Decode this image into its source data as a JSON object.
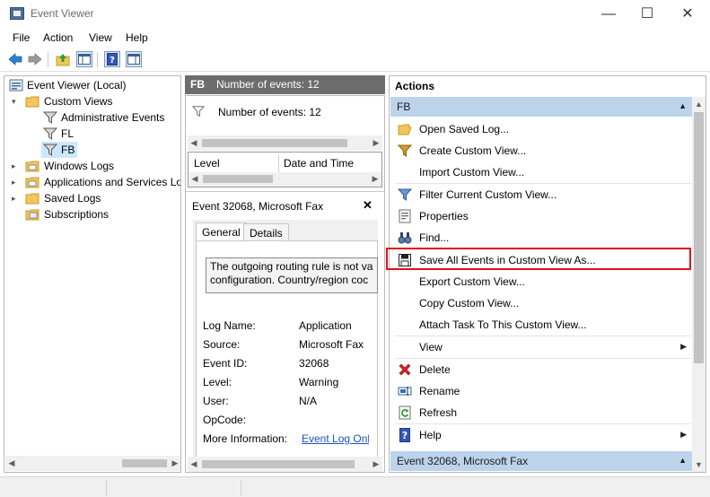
{
  "window": {
    "title": "Event Viewer",
    "min_glyph": "—",
    "max_glyph": "☐",
    "close_glyph": "✕"
  },
  "menu": [
    "File",
    "Action",
    "View",
    "Help"
  ],
  "tree": {
    "items": [
      {
        "label": "Event Viewer (Local)",
        "icon": "event-viewer-icon"
      },
      {
        "label": "Custom Views",
        "icon": "folder-icon"
      },
      {
        "label": "Administrative Events",
        "icon": "filter-icon"
      },
      {
        "label": "FL",
        "icon": "filter-icon"
      },
      {
        "label": "FB",
        "icon": "filter-icon"
      },
      {
        "label": "Windows Logs",
        "icon": "folder-icon"
      },
      {
        "label": "Applications and Services Lo",
        "icon": "folder-icon"
      },
      {
        "label": "Saved Logs",
        "icon": "folder-icon"
      },
      {
        "label": "Subscriptions",
        "icon": "subscriptions-icon"
      }
    ]
  },
  "middle": {
    "header_name": "FB",
    "header_count": "Number of events: 12",
    "filter_text": "Number of events: 12",
    "columns": [
      "Level",
      "Date and Time"
    ],
    "event_title": "Event 32068, Microsoft Fax",
    "close_glyph": "✕",
    "tabs": [
      "General",
      "Details"
    ],
    "message_line1": "The outgoing routing rule is not va",
    "message_line2": "configuration. Country/region coc",
    "props": [
      {
        "label": "Log Name:",
        "value": "Application"
      },
      {
        "label": "Source:",
        "value": "Microsoft Fax"
      },
      {
        "label": "Event ID:",
        "value": "32068"
      },
      {
        "label": "Level:",
        "value": "Warning"
      },
      {
        "label": "User:",
        "value": "N/A"
      },
      {
        "label": "OpCode:",
        "value": ""
      },
      {
        "label": "More Information:",
        "value": "Event Log Onl"
      }
    ]
  },
  "actions": {
    "title": "Actions",
    "section1": "FB",
    "section2": "Event 32068, Microsoft Fax",
    "items": [
      {
        "label": "Open Saved Log...",
        "icon": "open-folder-icon"
      },
      {
        "label": "Create Custom View...",
        "icon": "create-filter-icon"
      },
      {
        "label": "Import Custom View...",
        "icon": ""
      },
      {
        "label": "Filter Current Custom View...",
        "icon": "filter-icon"
      },
      {
        "label": "Properties",
        "icon": "properties-icon"
      },
      {
        "label": "Find...",
        "icon": "find-binoculars-icon"
      },
      {
        "label": "Save All Events in Custom View As...",
        "icon": "save-disk-icon"
      },
      {
        "label": "Export Custom View...",
        "icon": ""
      },
      {
        "label": "Copy Custom View...",
        "icon": ""
      },
      {
        "label": "Attach Task To This Custom View...",
        "icon": ""
      },
      {
        "label": "View",
        "icon": "",
        "submenu": true
      },
      {
        "label": "Delete",
        "icon": "delete-x-icon"
      },
      {
        "label": "Rename",
        "icon": "rename-icon"
      },
      {
        "label": "Refresh",
        "icon": "refresh-icon"
      },
      {
        "label": "Help",
        "icon": "help-icon",
        "submenu": true
      }
    ]
  },
  "colors": {
    "accent_section": "#bcd3ec",
    "highlight": "#e1121c",
    "mid_header": "#6d6d6d"
  }
}
